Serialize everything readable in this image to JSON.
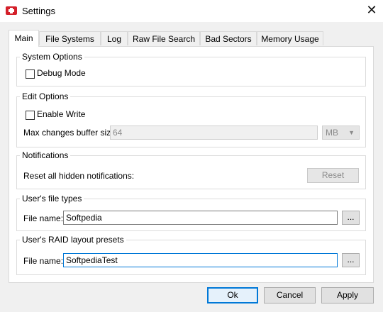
{
  "window": {
    "title": "Settings"
  },
  "tabs": [
    "Main",
    "File Systems",
    "Log",
    "Raw File Search",
    "Bad Sectors",
    "Memory Usage"
  ],
  "system_options": {
    "title": "System Options",
    "debug_mode": "Debug Mode"
  },
  "edit_options": {
    "title": "Edit Options",
    "enable_write": "Enable Write",
    "buffer_label": "Max changes buffer size:",
    "buffer_value": "64",
    "unit": "MB"
  },
  "notifications": {
    "title": "Notifications",
    "reset_label": "Reset all hidden notifications:",
    "reset_button": "Reset"
  },
  "file_types": {
    "title": "User's file types",
    "label": "File name:",
    "value": "Softpedia",
    "browse": "..."
  },
  "raid_presets": {
    "title": "User's RAID layout presets",
    "label": "File name:",
    "value": "SoftpediaTest",
    "browse": "..."
  },
  "footer": {
    "ok": "Ok",
    "cancel": "Cancel",
    "apply": "Apply"
  },
  "colors": {
    "accent": "#0078d7",
    "app_icon": "#d4202a"
  }
}
